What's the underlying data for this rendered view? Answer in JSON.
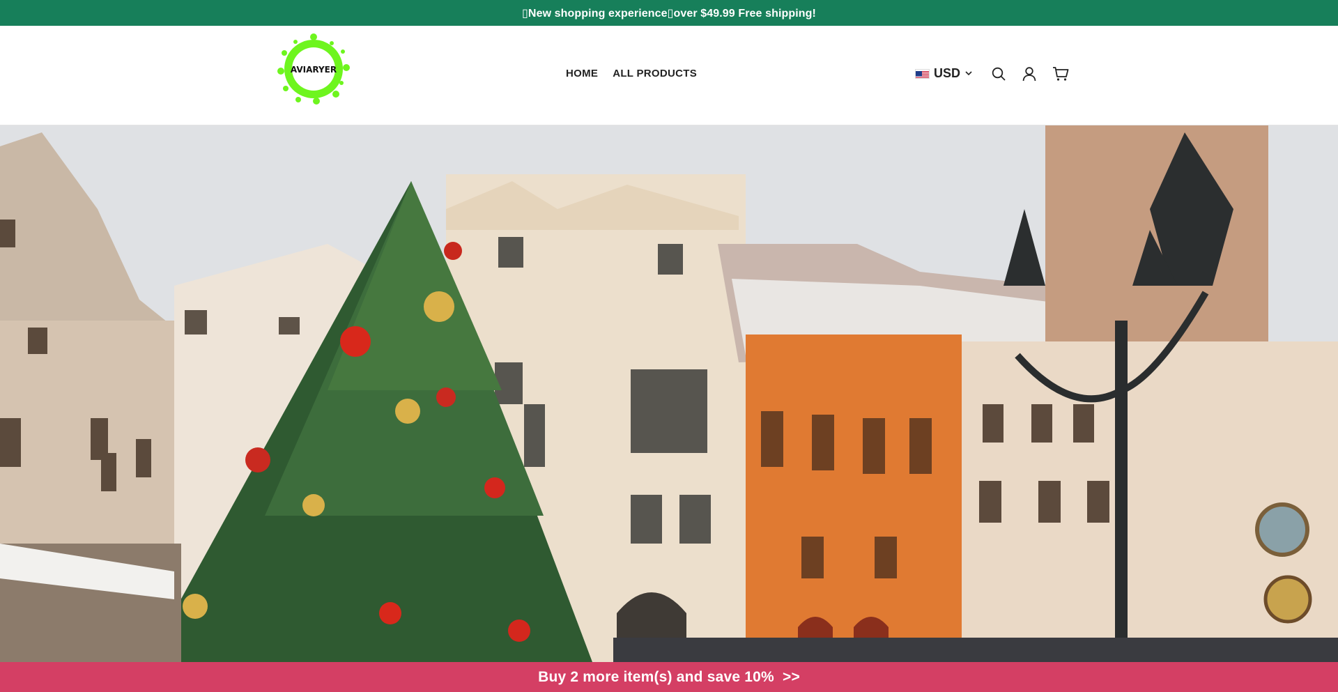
{
  "announcement": {
    "text": "▯New shopping experience▯over $49.99 Free shipping!"
  },
  "brand": {
    "logo_text": "AVIARYER",
    "logo_color": "#6ef51e"
  },
  "nav": {
    "items": [
      {
        "label": "HOME"
      },
      {
        "label": "ALL PRODUCTS"
      }
    ]
  },
  "currency": {
    "code": "USD",
    "flag": "us-flag-icon"
  },
  "header_icons": [
    "search-icon",
    "account-icon",
    "cart-icon"
  ],
  "hero": {
    "image": "winter-old-town-square-christmas-tree-photo"
  },
  "promo_bar": {
    "text": "Buy 2 more item(s) and save 10%  >>"
  },
  "colors": {
    "announcement_bg": "#177f5a",
    "promo_bg": "#d43f64"
  }
}
